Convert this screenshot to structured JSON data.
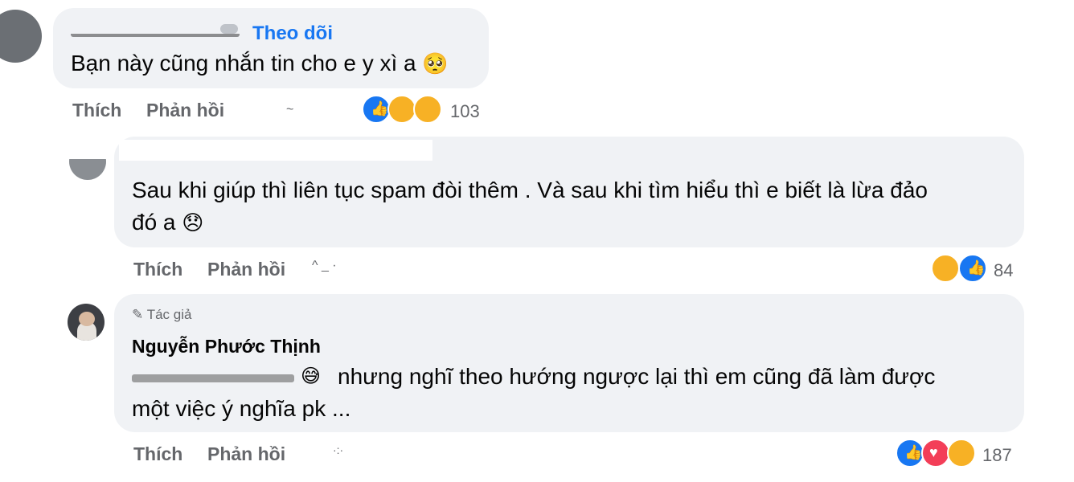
{
  "comments": [
    {
      "follow_label": "Theo dõi",
      "text": "Bạn này cũng nhắn tin cho e y xì a",
      "text_emoji": "🥺",
      "actions": {
        "like": "Thích",
        "reply": "Phản hồi"
      },
      "reaction_count": "103",
      "reactions": [
        "like-icon",
        "haha-icon",
        "sad-icon"
      ]
    },
    {
      "text_line1": "Sau khi giúp thì liên tục spam đòi thêm . Và sau khi tìm hiểu thì e biết là lừa đảo",
      "text_line2": "đó a",
      "text_emoji": "😞",
      "actions": {
        "like": "Thích",
        "reply": "Phản hồi"
      },
      "reaction_count": "84",
      "reactions": [
        "sad-icon",
        "like-icon"
      ]
    },
    {
      "author_badge": "Tác giả",
      "author_name": "Nguyễn Phước Thịnh",
      "text_line1": "nhưng nghĩ theo hướng ngược lại thì em cũng đã làm được",
      "text_line2": "một việc ý nghĩa pk ...",
      "text_emoji": "😅",
      "actions": {
        "like": "Thích",
        "reply": "Phản hồi"
      },
      "reaction_count": "187",
      "reactions": [
        "like-icon",
        "love-icon",
        "care-icon"
      ]
    }
  ],
  "colors": {
    "bubble": "#f0f2f5",
    "link": "#1877f2",
    "meta": "#65676b",
    "like": "#1877f2",
    "love": "#f33e58",
    "emoji": "#f7b125"
  }
}
